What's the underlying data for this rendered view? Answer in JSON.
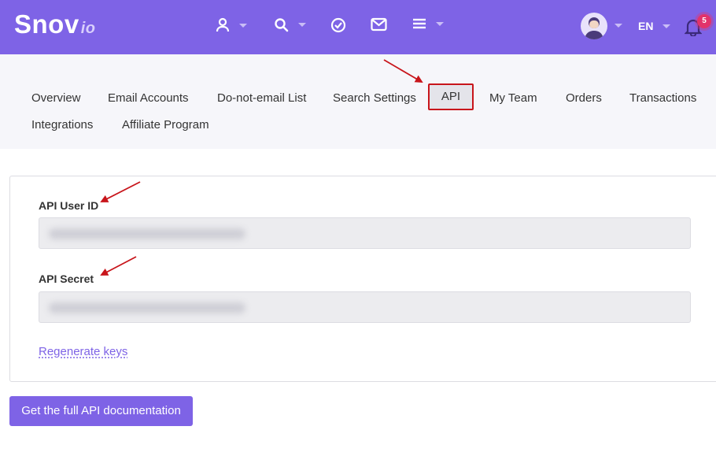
{
  "header": {
    "logo_main": "Snov",
    "logo_suffix": "io",
    "language": "EN",
    "notifications_count": "5",
    "icons": [
      "user-icon",
      "search-icon",
      "check-circle-icon",
      "mail-icon",
      "menu-icon",
      "avatar",
      "bell-icon"
    ]
  },
  "tabs": [
    {
      "label": "Overview"
    },
    {
      "label": "Email Accounts"
    },
    {
      "label": "Do-not-email List"
    },
    {
      "label": "Search Settings"
    },
    {
      "label": "API",
      "active": true
    },
    {
      "label": "My Team"
    },
    {
      "label": "Orders"
    },
    {
      "label": "Transactions"
    },
    {
      "label": "Integrations"
    },
    {
      "label": "Affiliate Program"
    }
  ],
  "api": {
    "user_id_label": "API User ID",
    "secret_label": "API Secret",
    "regenerate_label": "Regenerate keys",
    "docs_button_label": "Get the full API documentation"
  },
  "colors": {
    "brand": "#7e63e6",
    "highlight": "#c8151b",
    "badge": "#e2336b"
  }
}
